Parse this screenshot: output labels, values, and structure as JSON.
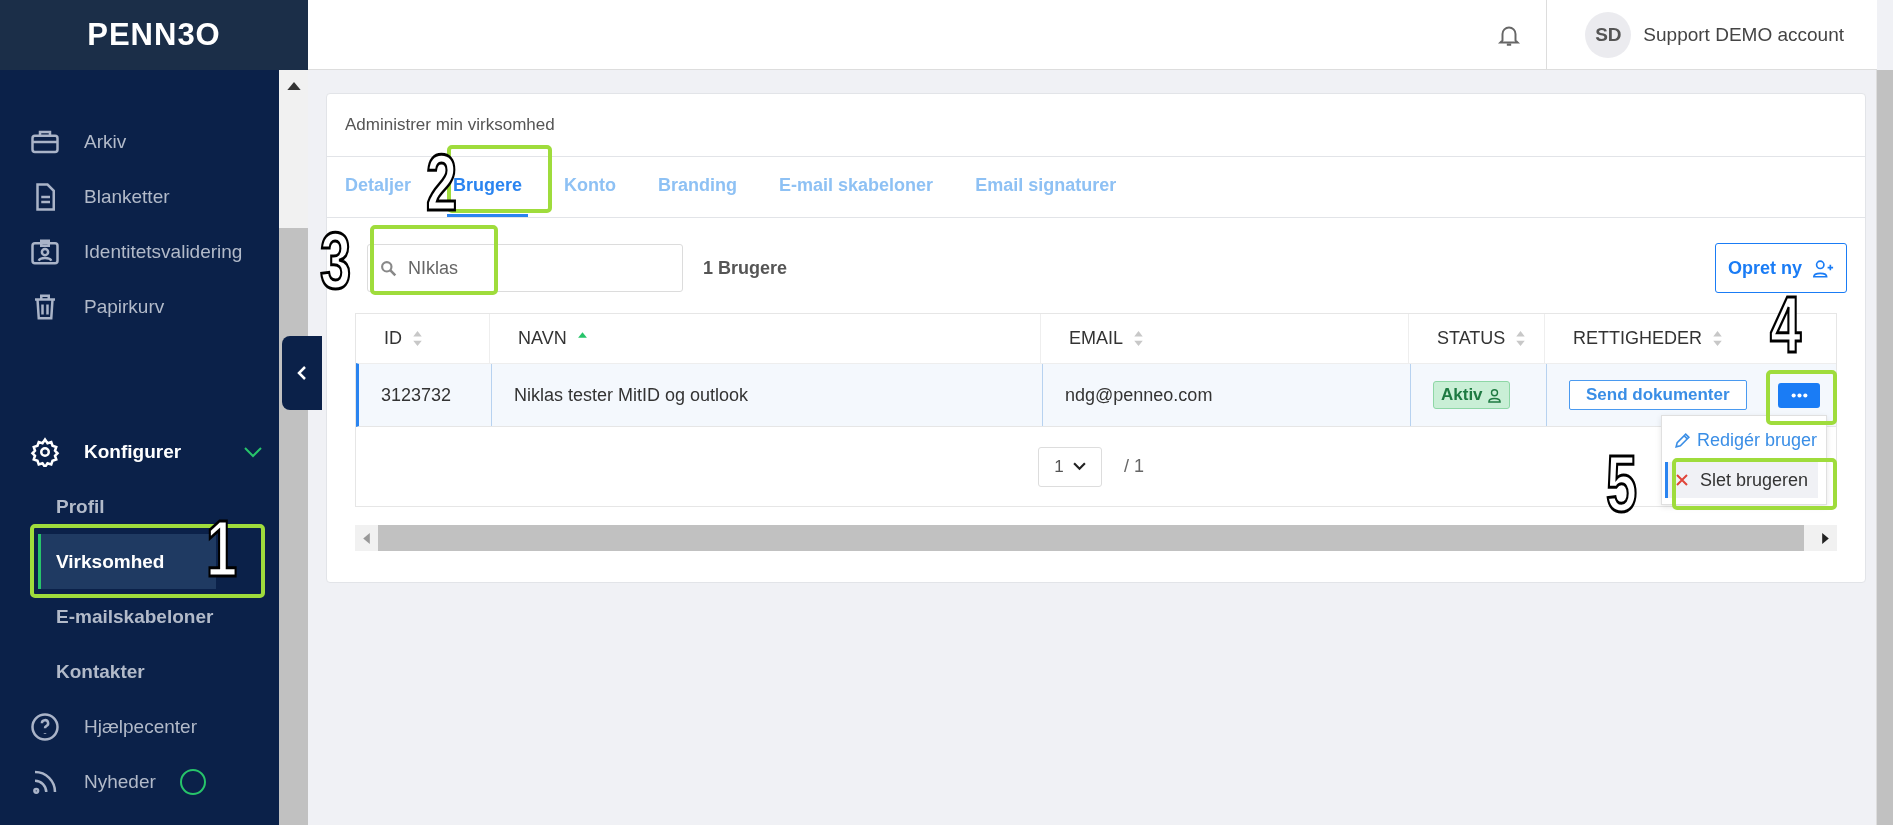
{
  "logo": "PENN3O",
  "sidebar": {
    "items": [
      {
        "kind": "nav",
        "label": "Arkiv"
      },
      {
        "kind": "nav",
        "label": "Blanketter"
      },
      {
        "kind": "nav",
        "label": "Identitetsvalidering"
      },
      {
        "kind": "nav",
        "label": "Papirkurv"
      },
      {
        "kind": "group",
        "label": "Konfigurer",
        "expanded": true,
        "children": [
          {
            "label": "Profil",
            "selected": false
          },
          {
            "label": "Virksomhed",
            "selected": true
          },
          {
            "label": "E-mailskabeloner",
            "selected": false
          },
          {
            "label": "Kontakter",
            "selected": false
          }
        ]
      },
      {
        "kind": "nav",
        "label": "Hjælpecenter"
      },
      {
        "kind": "news",
        "label": "Nyheder"
      }
    ]
  },
  "header": {
    "avatar": "SD",
    "account": "Support DEMO account"
  },
  "card": {
    "title": "Administrer min virksomhed",
    "tabs": [
      {
        "label": "Detaljer",
        "selected": false
      },
      {
        "label": "Brugere",
        "selected": true
      },
      {
        "label": "Konto",
        "selected": false
      },
      {
        "label": "Branding",
        "selected": false
      },
      {
        "label": "E-mail skabeloner",
        "selected": false
      },
      {
        "label": "Email signaturer",
        "selected": false
      }
    ],
    "search": {
      "value": "NIklas"
    },
    "count": "1 Brugere",
    "create_button": "Opret ny",
    "table": {
      "columns": [
        {
          "label": "ID",
          "sorted": false
        },
        {
          "label": "NAVN",
          "sorted": true
        },
        {
          "label": "EMAIL",
          "sorted": false
        },
        {
          "label": "STATUS",
          "sorted": false
        },
        {
          "label": "RETTIGHEDER",
          "sorted": false
        }
      ],
      "rows": [
        {
          "id": "3123732",
          "name": "Niklas tester MitID og outlook",
          "email": "ndg@penneo.com",
          "status": "Aktiv",
          "permission": "Send dokumenter",
          "selected": true
        }
      ]
    },
    "pagination": {
      "page": "1",
      "total": "/ 1"
    },
    "menu": [
      {
        "kind": "edit",
        "label": "Redigér bruger",
        "selected": false
      },
      {
        "kind": "delete",
        "label": "Slet brugeren",
        "selected": true
      }
    ]
  },
  "callouts": [
    {
      "number": "1"
    },
    {
      "number": "2"
    },
    {
      "number": "3"
    },
    {
      "number": "4"
    },
    {
      "number": "5"
    }
  ]
}
